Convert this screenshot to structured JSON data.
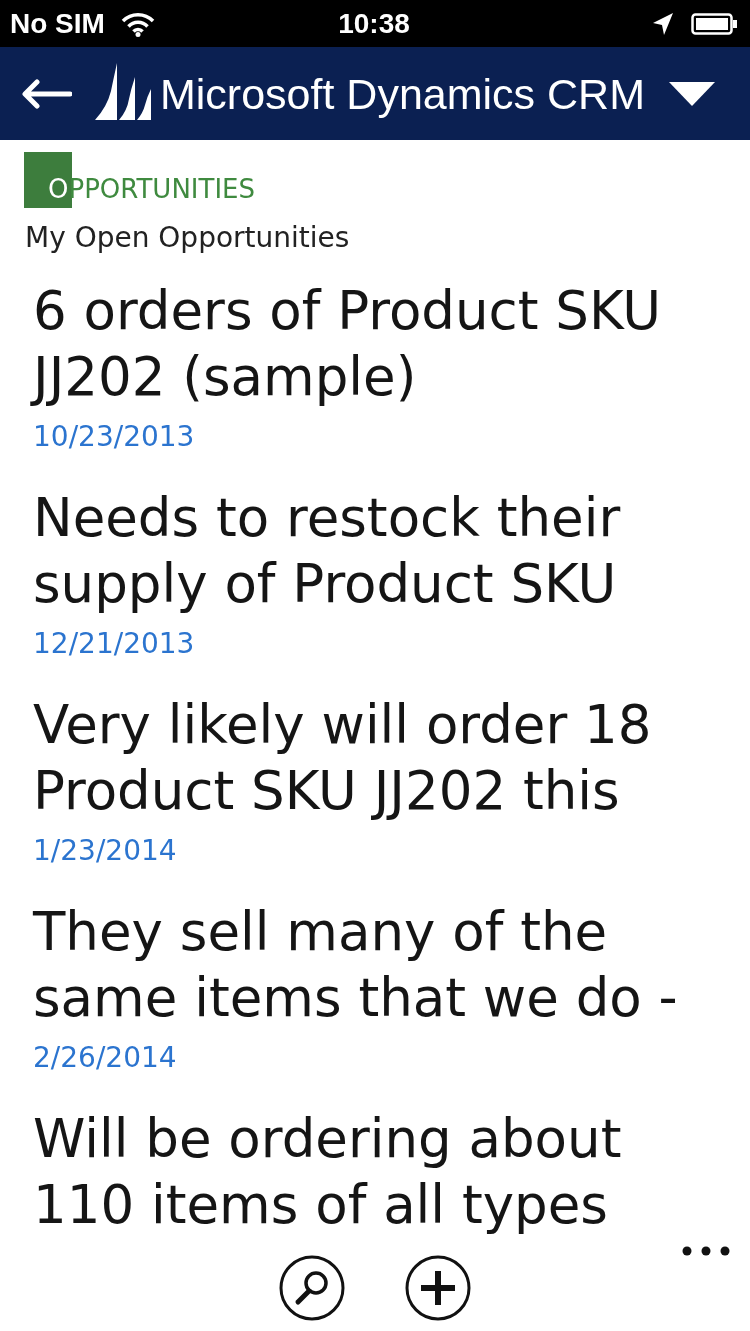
{
  "status_bar": {
    "carrier": "No SIM",
    "time": "10:38"
  },
  "header": {
    "title": "Microsoft Dynamics CRM"
  },
  "entity": {
    "name": "OPPORTUNITIES",
    "view": "My Open Opportunities"
  },
  "opportunities": [
    {
      "title": "6 orders of Product SKU JJ202 (sample)",
      "date": "10/23/2013"
    },
    {
      "title": "Needs to restock their supply of Product SKU",
      "date": "12/21/2013"
    },
    {
      "title": "Very likely will order 18 Product SKU JJ202 this",
      "date": "1/23/2014"
    },
    {
      "title": "They sell many of the same items that we do -",
      "date": "2/26/2014"
    },
    {
      "title": "Will be ordering about 110 items of all types"
    }
  ]
}
